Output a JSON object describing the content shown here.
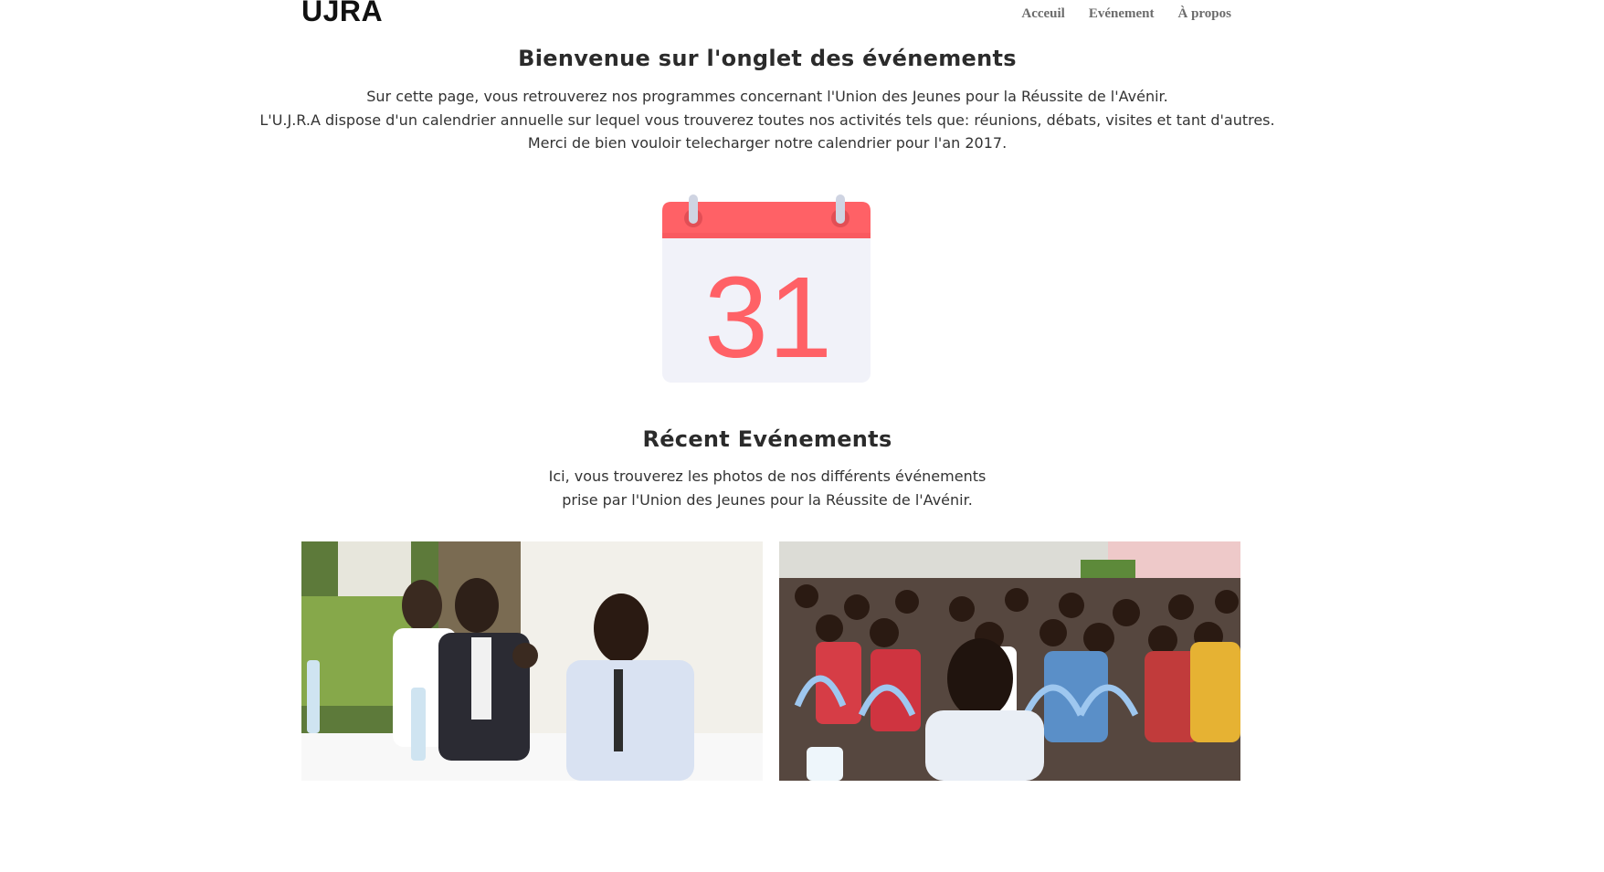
{
  "header": {
    "brand": "UJRA",
    "nav": [
      "Acceuil",
      "Evénement",
      "À propos"
    ]
  },
  "welcome": {
    "title": "Bienvenue sur l'onglet des événements",
    "lines": [
      "Sur cette page, vous retrouverez nos programmes concernant l'Union des Jeunes pour la Réussite de l'Avénir.",
      "L'U.J.R.A dispose d'un calendrier annuelle sur lequel vous trouverez toutes nos activités tels que: réunions, débats, visites et tant d'autres.",
      "Merci de bien vouloir telecharger notre calendrier pour l'an 2017."
    ]
  },
  "calendar": {
    "day": "31",
    "icon": "calendar-icon",
    "accent": "#ff6166",
    "page_color": "#f1f2f9"
  },
  "recent": {
    "title": "Récent Evénements",
    "lines": [
      "Ici, vous trouverez les photos de nos différents événements",
      "prise par l'Union des Jeunes pour la Réussite de l'Avénir."
    ]
  },
  "photos": [
    "panel-discussion-photo",
    "audience-photo"
  ]
}
